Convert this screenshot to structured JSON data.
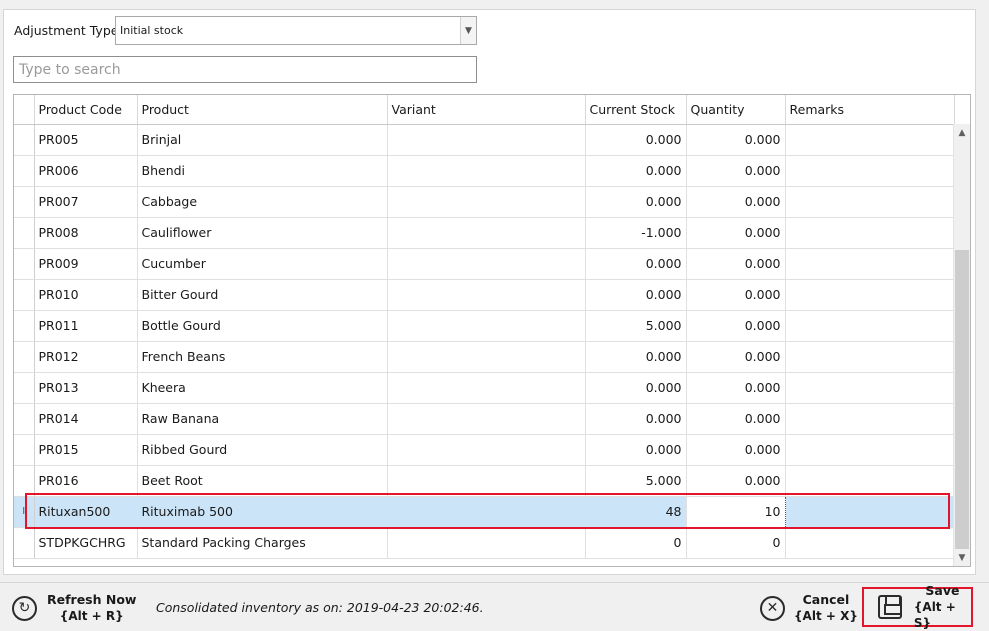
{
  "adjustment": {
    "label": "Adjustment Type",
    "selected": "Initial stock"
  },
  "search": {
    "placeholder": "Type to search",
    "value": ""
  },
  "grid": {
    "columns": [
      "Product Code",
      "Product",
      "Variant",
      "Current Stock",
      "Quantity",
      "Remarks"
    ],
    "rows": [
      {
        "code": "PR005",
        "product": "Brinjal",
        "variant": "",
        "stock": "0.000",
        "qty": "0.000",
        "remarks": ""
      },
      {
        "code": "PR006",
        "product": "Bhendi",
        "variant": "",
        "stock": "0.000",
        "qty": "0.000",
        "remarks": ""
      },
      {
        "code": "PR007",
        "product": "Cabbage",
        "variant": "",
        "stock": "0.000",
        "qty": "0.000",
        "remarks": ""
      },
      {
        "code": "PR008",
        "product": "Cauliflower",
        "variant": "",
        "stock": "-1.000",
        "qty": "0.000",
        "remarks": ""
      },
      {
        "code": "PR009",
        "product": "Cucumber",
        "variant": "",
        "stock": "0.000",
        "qty": "0.000",
        "remarks": ""
      },
      {
        "code": "PR010",
        "product": "Bitter Gourd",
        "variant": "",
        "stock": "0.000",
        "qty": "0.000",
        "remarks": ""
      },
      {
        "code": "PR011",
        "product": "Bottle Gourd",
        "variant": "",
        "stock": "5.000",
        "qty": "0.000",
        "remarks": ""
      },
      {
        "code": "PR012",
        "product": "French Beans",
        "variant": "",
        "stock": "0.000",
        "qty": "0.000",
        "remarks": ""
      },
      {
        "code": "PR013",
        "product": "Kheera",
        "variant": "",
        "stock": "0.000",
        "qty": "0.000",
        "remarks": ""
      },
      {
        "code": "PR014",
        "product": "Raw Banana",
        "variant": "",
        "stock": "0.000",
        "qty": "0.000",
        "remarks": ""
      },
      {
        "code": "PR015",
        "product": "Ribbed Gourd",
        "variant": "",
        "stock": "0.000",
        "qty": "0.000",
        "remarks": ""
      },
      {
        "code": "PR016",
        "product": "Beet Root",
        "variant": "",
        "stock": "5.000",
        "qty": "0.000",
        "remarks": ""
      },
      {
        "code": "Rituxan500",
        "product": "Rituximab 500",
        "variant": "",
        "stock": "48",
        "qty": "10",
        "remarks": "",
        "selected": true
      },
      {
        "code": "STDPKGCHRG",
        "product": "Standard Packing Charges",
        "variant": "",
        "stock": "0",
        "qty": "0",
        "remarks": ""
      }
    ],
    "selected_row_marker": "I"
  },
  "footer": {
    "refresh_label": "Refresh Now",
    "refresh_key": "{Alt + R}",
    "status_text": "Consolidated inventory as on: 2019-04-23 20:02:46.",
    "cancel_label": "Cancel",
    "cancel_key": "{Alt + X}",
    "save_label": "Save",
    "save_key": "{Alt + S}"
  },
  "colors": {
    "highlight": "#e3152b",
    "selection": "#cce4f7"
  },
  "icons": {
    "refresh": "refresh-icon",
    "cancel": "close-circle-icon",
    "save": "save-icon",
    "dropdown": "chevron-down-icon",
    "scroll_up": "chevron-up-icon",
    "scroll_down": "chevron-down-icon"
  }
}
